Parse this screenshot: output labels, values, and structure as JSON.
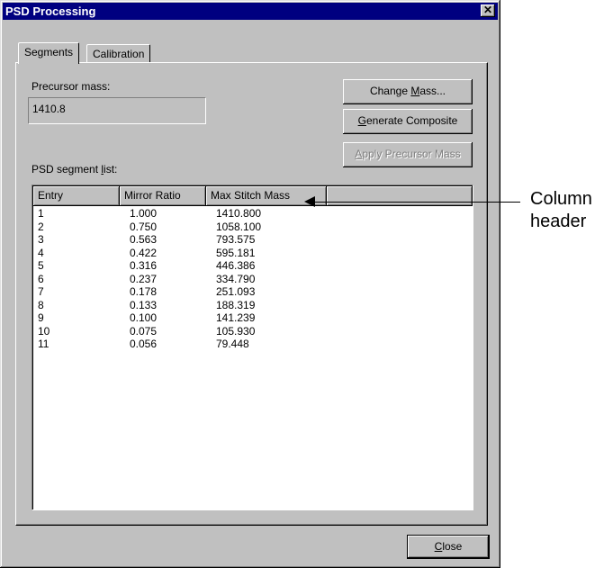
{
  "window": {
    "title": "PSD Processing",
    "close_glyph": "✕"
  },
  "tabs": [
    {
      "label": "Segments",
      "active": true
    },
    {
      "label": "Calibration",
      "active": false
    }
  ],
  "precursor": {
    "label": "Precursor mass:",
    "value": "1410.8"
  },
  "buttons": {
    "change_mass": {
      "pre": "Change ",
      "mnemonic": "M",
      "post": "ass..."
    },
    "generate_composite": {
      "pre": "",
      "mnemonic": "G",
      "post": "enerate Composite"
    },
    "apply_precursor_mass": {
      "pre": "",
      "mnemonic": "A",
      "post": "pply Precursor Mass",
      "enabled": false
    },
    "close": {
      "pre": "",
      "mnemonic": "C",
      "post": "lose"
    }
  },
  "segment_list": {
    "label_pre": "PSD segment ",
    "label_mnemonic": "l",
    "label_post": "ist:",
    "columns": [
      "Entry",
      "Mirror Ratio",
      "Max Stitch Mass"
    ],
    "rows": [
      [
        "1",
        "1.000",
        "1410.800"
      ],
      [
        "2",
        "0.750",
        "1058.100"
      ],
      [
        "3",
        "0.563",
        "793.575"
      ],
      [
        "4",
        "0.422",
        "595.181"
      ],
      [
        "5",
        "0.316",
        "446.386"
      ],
      [
        "6",
        "0.237",
        "334.790"
      ],
      [
        "7",
        "0.178",
        "251.093"
      ],
      [
        "8",
        "0.133",
        "188.319"
      ],
      [
        "9",
        "0.100",
        "141.239"
      ],
      [
        "10",
        "0.075",
        "105.930"
      ],
      [
        "11",
        "0.056",
        "79.448"
      ]
    ]
  },
  "annotation": {
    "line1": "Column",
    "line2": "header"
  }
}
